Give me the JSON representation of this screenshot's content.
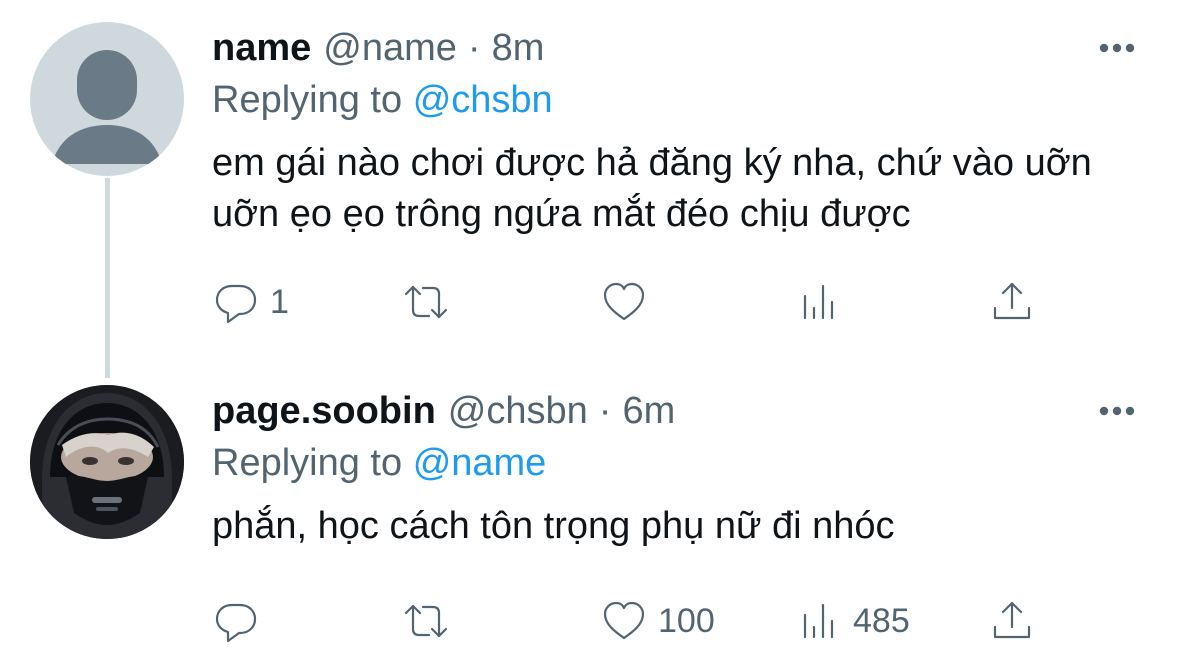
{
  "tweets": [
    {
      "display_name": "name",
      "handle": "@name",
      "separator": "·",
      "time": "8m",
      "reply_prefix": "Replying to",
      "reply_to": "@chsbn",
      "text": "em gái nào chơi được hả đăng ký nha, chứ vào uỡn uỡn ẹo ẹo trông ngứa mắt đéo chịu được",
      "avatar": "default-avatar",
      "actions": {
        "reply_count": "1",
        "retweet_count": "",
        "like_count": "",
        "view_count": ""
      }
    },
    {
      "display_name": "page.soobin",
      "handle": "@chsbn",
      "separator": "·",
      "time": "6m",
      "reply_prefix": "Replying to",
      "reply_to": "@name",
      "text": "phắn, học cách tôn trọng phụ nữ đi nhóc",
      "avatar": "photo-avatar",
      "actions": {
        "reply_count": "",
        "retweet_count": "",
        "like_count": "100",
        "view_count": "485"
      }
    }
  ],
  "colors": {
    "text": "#0f1419",
    "secondary": "#536471",
    "mention": "#1d9bf0",
    "thread_line": "#cfd9de",
    "default_avatar_bg": "#ced8dd",
    "default_avatar_fg": "#6b7a87"
  },
  "icons": [
    "more-icon",
    "reply-icon",
    "retweet-icon",
    "like-icon",
    "views-icon",
    "share-icon"
  ]
}
